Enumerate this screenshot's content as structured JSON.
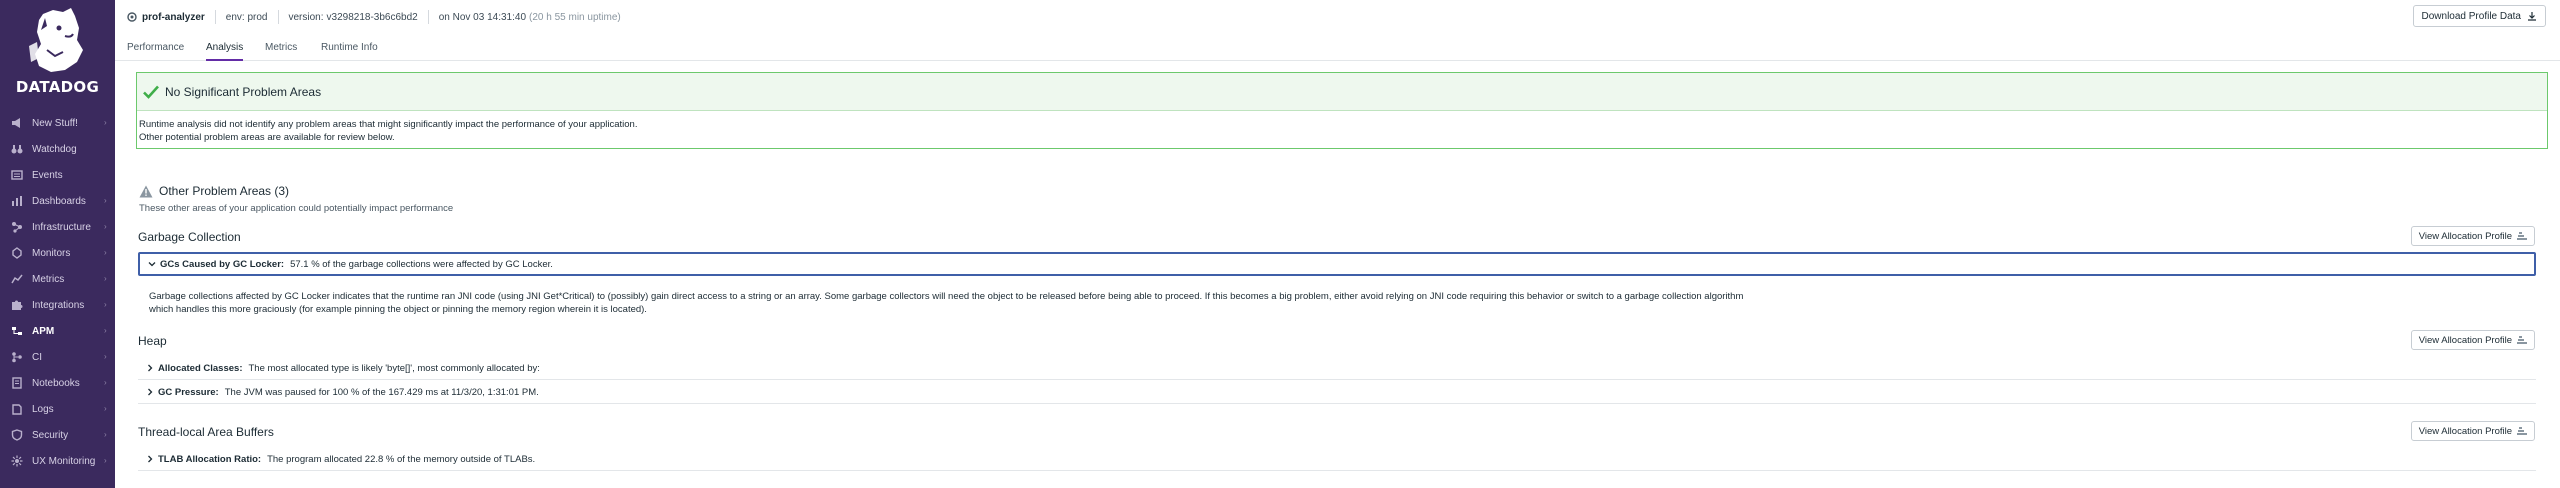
{
  "sidebar": {
    "logo_text": "DATADOG",
    "items": [
      {
        "label": "New Stuff!",
        "icon": "megaphone-icon",
        "has_chevron": true
      },
      {
        "label": "Watchdog",
        "icon": "binoculars-icon",
        "has_chevron": false
      },
      {
        "label": "Events",
        "icon": "events-list-icon",
        "has_chevron": false
      },
      {
        "label": "Dashboards",
        "icon": "dashboard-icon",
        "has_chevron": true
      },
      {
        "label": "Infrastructure",
        "icon": "infrastructure-icon",
        "has_chevron": true
      },
      {
        "label": "Monitors",
        "icon": "monitor-icon",
        "has_chevron": true
      },
      {
        "label": "Metrics",
        "icon": "metrics-icon",
        "has_chevron": true
      },
      {
        "label": "Integrations",
        "icon": "puzzle-icon",
        "has_chevron": true
      },
      {
        "label": "APM",
        "icon": "apm-icon",
        "has_chevron": true,
        "active": true
      },
      {
        "label": "CI",
        "icon": "ci-icon",
        "has_chevron": true
      },
      {
        "label": "Notebooks",
        "icon": "notebook-icon",
        "has_chevron": true
      },
      {
        "label": "Logs",
        "icon": "logs-icon",
        "has_chevron": true
      },
      {
        "label": "Security",
        "icon": "shield-icon",
        "has_chevron": true
      },
      {
        "label": "UX Monitoring",
        "icon": "ux-monitoring-icon",
        "has_chevron": true
      }
    ]
  },
  "header": {
    "service": "prof-analyzer",
    "env": "env: prod",
    "version_label": "version:",
    "version_value": "v3298218-3b6c6bd2",
    "date": "on Nov 03 14:31:40",
    "uptime": "(20 h 55 min uptime)",
    "download_label": "Download Profile Data"
  },
  "tabs": [
    {
      "label": "Performance",
      "active": false
    },
    {
      "label": "Analysis",
      "active": true
    },
    {
      "label": "Metrics",
      "active": false
    },
    {
      "label": "Runtime Info",
      "active": false
    }
  ],
  "banner": {
    "title": "No Significant Problem Areas",
    "line1": "Runtime analysis did not identify any problem areas that might significantly impact the performance of your application.",
    "line2": "Other potential problem areas are available for review below."
  },
  "other_areas": {
    "title": "Other Problem Areas (3)",
    "subtitle": "These other areas of your application could potentially impact performance"
  },
  "sections": {
    "gc": {
      "title": "Garbage Collection",
      "button": "View Allocation Profile",
      "row_label": "GCs Caused by GC Locker:",
      "row_text": "57.1 % of the garbage collections were affected by GC Locker.",
      "detail_line1": "Garbage collections affected by GC Locker indicates that the runtime ran JNI code (using JNI Get*Critical) to (possibly) gain direct access to a string or an array. Some garbage collectors will need the object to be released before being able to proceed. If this becomes a big problem, either avoid relying on JNI code requiring this behavior or switch to a garbage collection algorithm",
      "detail_line2": "which handles this more graciously (for example pinning the object or pinning the memory region wherein it is located)."
    },
    "heap": {
      "title": "Heap",
      "button": "View Allocation Profile",
      "row1_label": "Allocated Classes:",
      "row1_text": "The most allocated type is likely 'byte[]', most commonly allocated by:",
      "row2_label": "GC Pressure:",
      "row2_text": "The JVM was paused for 100 % of the 167.429 ms at 11/3/20, 1:31:01 PM."
    },
    "tlab": {
      "title": "Thread-local Area Buffers",
      "button": "View Allocation Profile",
      "row_label": "TLAB Allocation Ratio:",
      "row_text": "The program allocated 22.8 % of the memory outside of TLABs."
    }
  },
  "colors": {
    "sidebar_bg": "#3b2a5e",
    "accent": "#632ca6",
    "success_border": "#6cc96c",
    "focus_border": "#3f5fa8"
  }
}
